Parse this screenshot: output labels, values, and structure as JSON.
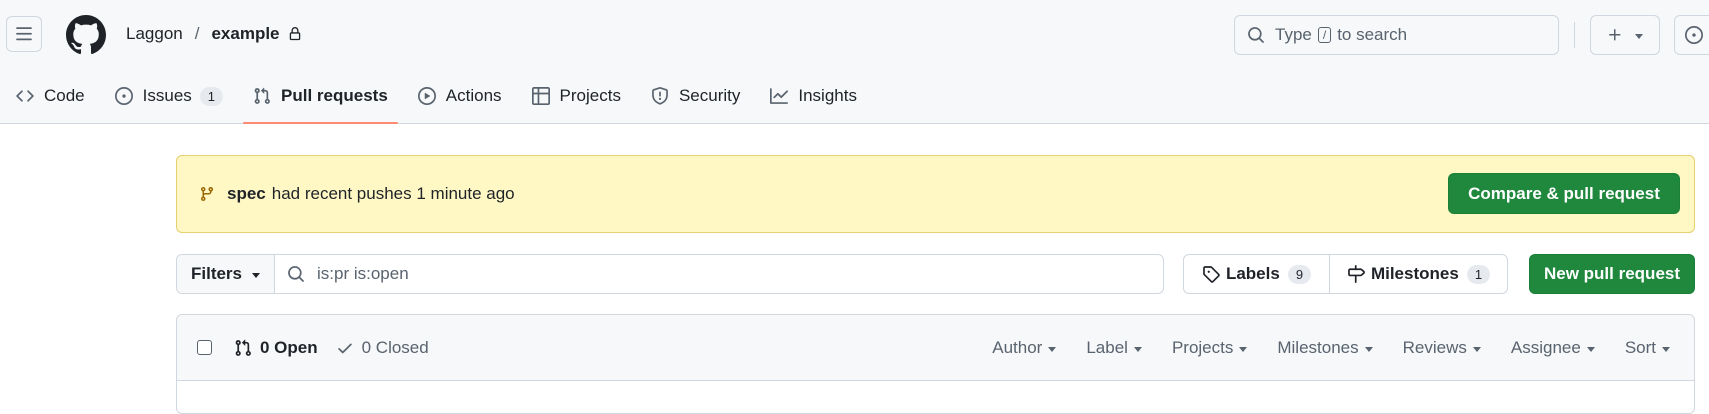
{
  "repo": {
    "owner": "Laggon",
    "separator": "/",
    "name": "example"
  },
  "search": {
    "prefix": "Type",
    "key": "/",
    "suffix": "to search"
  },
  "tabs": [
    {
      "label": "Code",
      "icon": "code-icon"
    },
    {
      "label": "Issues",
      "icon": "issue-opened-icon",
      "count": "1"
    },
    {
      "label": "Pull requests",
      "icon": "git-pull-request-icon",
      "active": true
    },
    {
      "label": "Actions",
      "icon": "play-icon"
    },
    {
      "label": "Projects",
      "icon": "table-icon"
    },
    {
      "label": "Security",
      "icon": "shield-icon"
    },
    {
      "label": "Insights",
      "icon": "graph-icon"
    }
  ],
  "banner": {
    "branch": "spec",
    "message": "had recent pushes 1 minute ago",
    "button": "Compare & pull request"
  },
  "filters": {
    "button": "Filters",
    "query": "is:pr is:open"
  },
  "labels": {
    "label": "Labels",
    "count": "9"
  },
  "milestones": {
    "label": "Milestones",
    "count": "1"
  },
  "new_pr_button": "New pull request",
  "list": {
    "open_label": "0 Open",
    "closed_label": "0 Closed",
    "sort_filters": [
      "Author",
      "Label",
      "Projects",
      "Milestones",
      "Reviews",
      "Assignee",
      "Sort"
    ]
  },
  "colors": {
    "accent_green": "#1f883d",
    "banner_bg": "#fff8c5",
    "active_tab_underline": "#fd8c73"
  }
}
